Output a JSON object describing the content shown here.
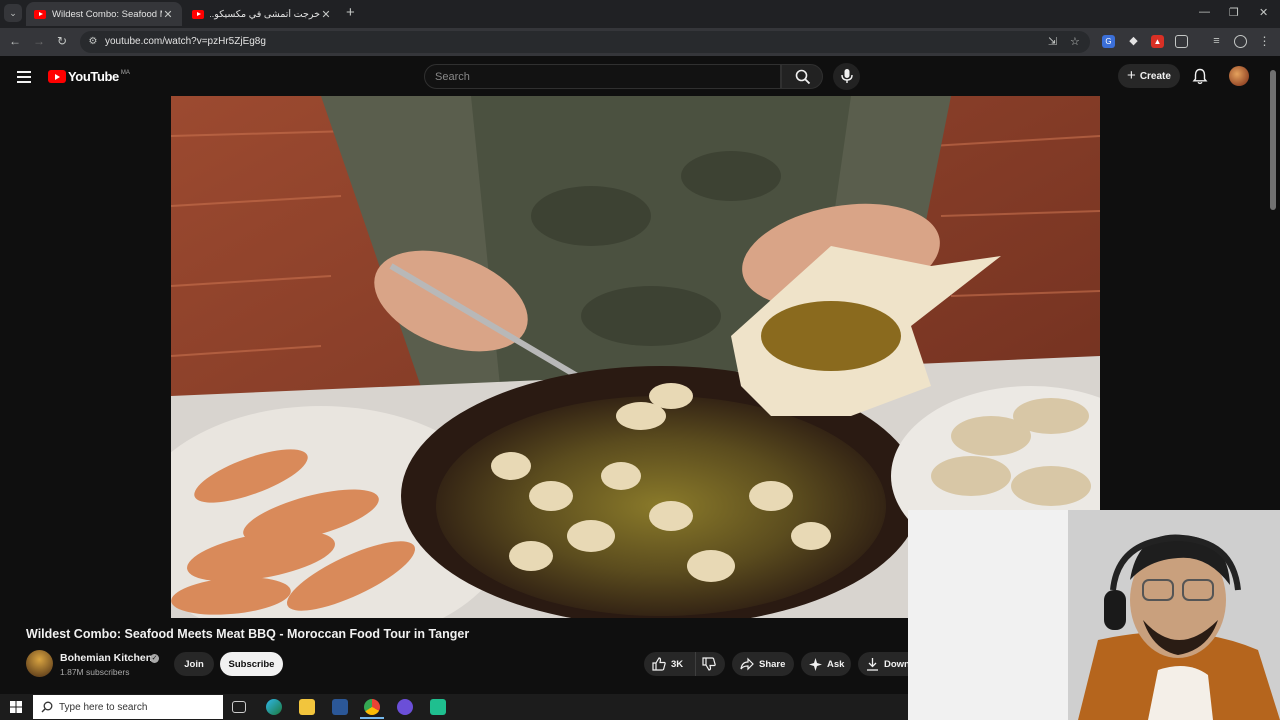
{
  "browser": {
    "tabs": [
      {
        "title": "Wildest Combo: Seafood Meets",
        "active": true
      },
      {
        "title": "خرجت أتمشى في مكسيكو... وتعرّ",
        "active": false
      }
    ],
    "new_tab_label": "+",
    "window_controls": {
      "minimize": "—",
      "restore": "❐",
      "close": "✕"
    },
    "url": "youtube.com/watch?v=pzHr5ZjEg8g"
  },
  "youtube": {
    "logo_text": "YouTube",
    "country_code": "MA",
    "search_placeholder": "Search",
    "create_label": "Create"
  },
  "video": {
    "title": "Wildest Combo: Seafood Meets Meat BBQ - Moroccan Food Tour in Tanger",
    "channel": {
      "name": "Bohemian Kitchen",
      "verified": true,
      "subscribers": "1.87M subscribers"
    },
    "join_label": "Join",
    "subscribe_label": "Subscribe",
    "likes": "3K",
    "share_label": "Share",
    "ask_label": "Ask",
    "download_label": "Down"
  },
  "taskbar": {
    "search_placeholder": "Type here to search"
  },
  "colors": {
    "accent": "#ff0000",
    "background": "#0f0f0f",
    "pill": "#272727"
  }
}
